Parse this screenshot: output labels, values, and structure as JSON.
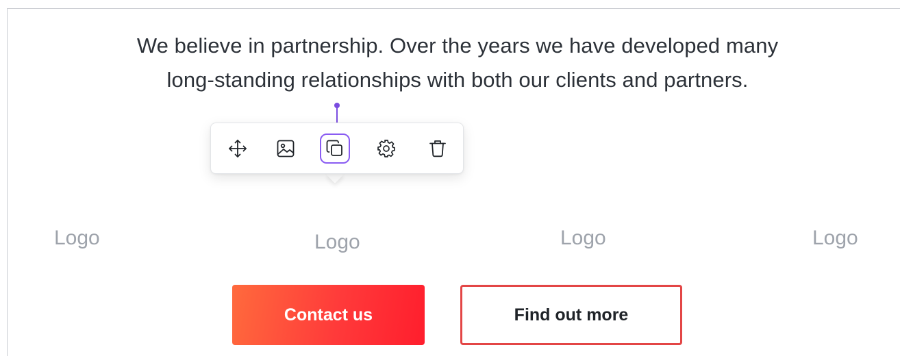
{
  "intro": {
    "line1": "We believe in partnership. Over the years we have developed many",
    "line2": "long-standing relationships with both our clients and partners."
  },
  "toolbar": {
    "tools": [
      {
        "name": "move",
        "icon": "move-arrows-icon",
        "active": false
      },
      {
        "name": "image",
        "icon": "image-icon",
        "active": false
      },
      {
        "name": "duplicate",
        "icon": "duplicate-icon",
        "active": true
      },
      {
        "name": "settings",
        "icon": "gear-icon",
        "active": false
      },
      {
        "name": "delete",
        "icon": "trash-icon",
        "active": false
      }
    ],
    "accent_color": "#8a5cf2"
  },
  "logos": [
    "Logo",
    "Logo",
    "Logo",
    "Logo"
  ],
  "buttons": {
    "contact_label": "Contact us",
    "find_label": "Find out more",
    "primary_color": "#ff3a3a",
    "secondary_border_color": "#e34646"
  }
}
